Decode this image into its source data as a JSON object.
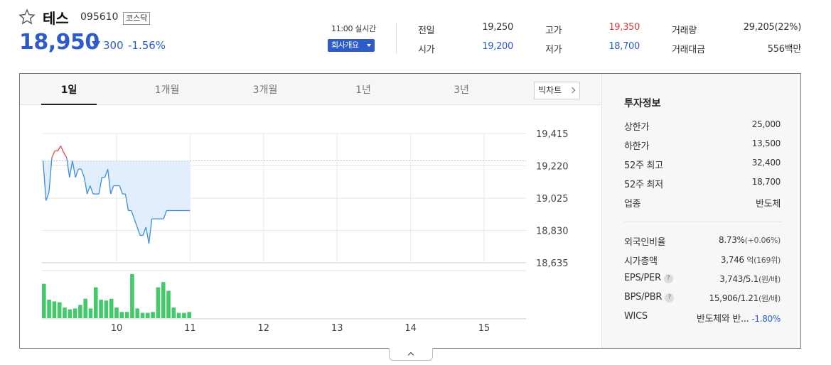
{
  "stock": {
    "name": "테스",
    "code": "095610",
    "market": "코스닥",
    "price": "18,950",
    "change": "300",
    "change_pct": "-1.56%",
    "realtime": "11:00 실시간",
    "company_btn": "회사개요"
  },
  "quote": {
    "prev_label": "전일",
    "prev": "19,250",
    "high_label": "고가",
    "high": "19,350",
    "volume_label": "거래량",
    "volume": "29,205(22%)",
    "open_label": "시가",
    "open": "19,200",
    "low_label": "저가",
    "low": "18,700",
    "amount_label": "거래대금",
    "amount": "556백만"
  },
  "tabs": [
    "1일",
    "1개월",
    "3개월",
    "1년",
    "3년"
  ],
  "big_chart_btn": "빅차트",
  "invest": {
    "title": "투자정보",
    "rows": [
      {
        "label": "상한가",
        "value": "25,000",
        "color": "#e03a3a"
      },
      {
        "label": "하한가",
        "value": "13,500",
        "color": "#2d5cc8"
      },
      {
        "label": "52주 최고",
        "value": "32,400"
      },
      {
        "label": "52주 최저",
        "value": "18,700"
      },
      {
        "label": "업종",
        "value": "반도체"
      }
    ],
    "rows2": [
      {
        "label": "외국인비율",
        "value": "8.73%",
        "sub": "(+0.06%)"
      },
      {
        "label": "시가총액",
        "value": "3,746",
        "sub": "억(169위)"
      },
      {
        "label": "EPS/PER",
        "value": "3,743/5.1",
        "sub": "(원/배)",
        "help": "?"
      },
      {
        "label": "BPS/PBR",
        "value": "15,906/1.21",
        "sub": "(원/배)",
        "help": "?"
      },
      {
        "label": "WICS",
        "value": "반도체와 반...",
        "extra": "-1.80%"
      }
    ]
  },
  "chart_data": {
    "type": "line",
    "y_ticks": [
      "19,415",
      "19,220",
      "19,025",
      "18,830",
      "18,635"
    ],
    "ylim": [
      18635,
      19415
    ],
    "x_ticks": [
      "10",
      "11",
      "12",
      "13",
      "14",
      "15"
    ],
    "xlim": [
      9.0,
      15.6
    ],
    "reference": 19250,
    "colors": {
      "line": "#3b8ed8",
      "above": "#e04646",
      "fill": "#e3eefc",
      "volume": "#44c96b"
    },
    "series": [
      {
        "x": [
          9.0,
          9.04,
          9.08,
          9.12,
          9.16,
          9.2,
          9.24,
          9.28,
          9.32,
          9.36,
          9.4,
          9.44,
          9.48,
          9.52,
          9.56,
          9.6,
          9.64,
          9.68,
          9.72,
          9.76,
          9.8,
          9.84,
          9.88,
          9.92,
          9.96,
          10.0,
          10.04,
          10.08,
          10.12,
          10.16,
          10.2,
          10.24,
          10.28,
          10.32,
          10.36,
          10.4,
          10.44,
          10.48,
          10.52,
          10.56,
          10.6,
          10.64,
          10.68,
          10.72,
          10.76,
          10.8,
          10.84,
          10.88,
          10.92,
          10.96,
          11.0
        ],
        "y": [
          19250,
          19010,
          19060,
          19270,
          19310,
          19310,
          19340,
          19300,
          19270,
          19150,
          19250,
          19150,
          19200,
          19200,
          19150,
          19050,
          19100,
          19050,
          19050,
          19050,
          19150,
          19150,
          19200,
          19050,
          19100,
          19100,
          19100,
          19050,
          19050,
          18950,
          18950,
          18900,
          18850,
          18800,
          18800,
          18850,
          18750,
          18900,
          18900,
          18900,
          18900,
          18900,
          18950,
          18950,
          18950,
          18950,
          18950,
          18950,
          18950,
          18950,
          18950
        ]
      }
    ],
    "volume": [
      80,
      45,
      40,
      38,
      32,
      20,
      18,
      20,
      28,
      45,
      22,
      70,
      42,
      40,
      40,
      25,
      20,
      22,
      20,
      35,
      20,
      42,
      30,
      25,
      15,
      12,
      10,
      8,
      6,
      5,
      5,
      4,
      4,
      4,
      4,
      4,
      4,
      4,
      4,
      4,
      4,
      4,
      4,
      4,
      4,
      4,
      4,
      4,
      4,
      4,
      4
    ],
    "volume_heights": [
      78,
      42,
      38,
      36,
      24,
      20,
      22,
      30,
      44,
      22,
      70,
      42,
      40,
      44,
      24,
      14,
      14,
      100,
      22,
      12,
      12,
      14,
      70,
      82,
      62,
      24,
      12,
      12,
      14
    ]
  }
}
